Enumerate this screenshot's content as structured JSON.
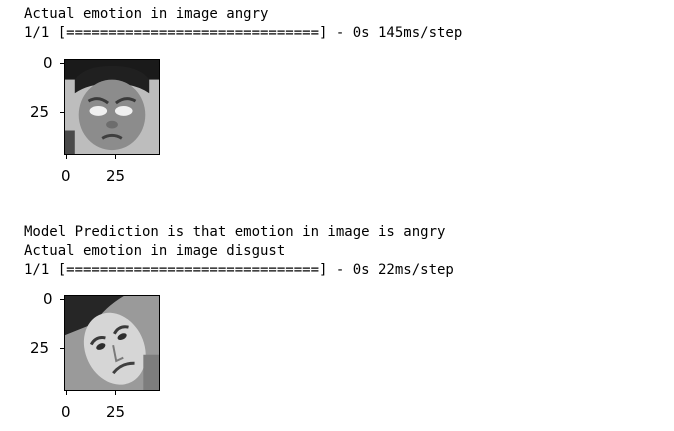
{
  "output": {
    "line1": "Actual emotion in image angry",
    "line2": "1/1 [==============================] - 0s 145ms/step",
    "line3": "Model Prediction is that emotion in image is angry",
    "line4": "Actual emotion in image disgust",
    "line5": "1/1 [==============================] - 0s 22ms/step"
  },
  "plots": [
    {
      "y_ticks": [
        "0",
        "25"
      ],
      "x_ticks": [
        "0",
        "25"
      ],
      "image_icon": "grayscale-face-angry-child"
    },
    {
      "y_ticks": [
        "0",
        "25"
      ],
      "x_ticks": [
        "0",
        "25"
      ],
      "image_icon": "grayscale-face-disgust-man"
    }
  ]
}
